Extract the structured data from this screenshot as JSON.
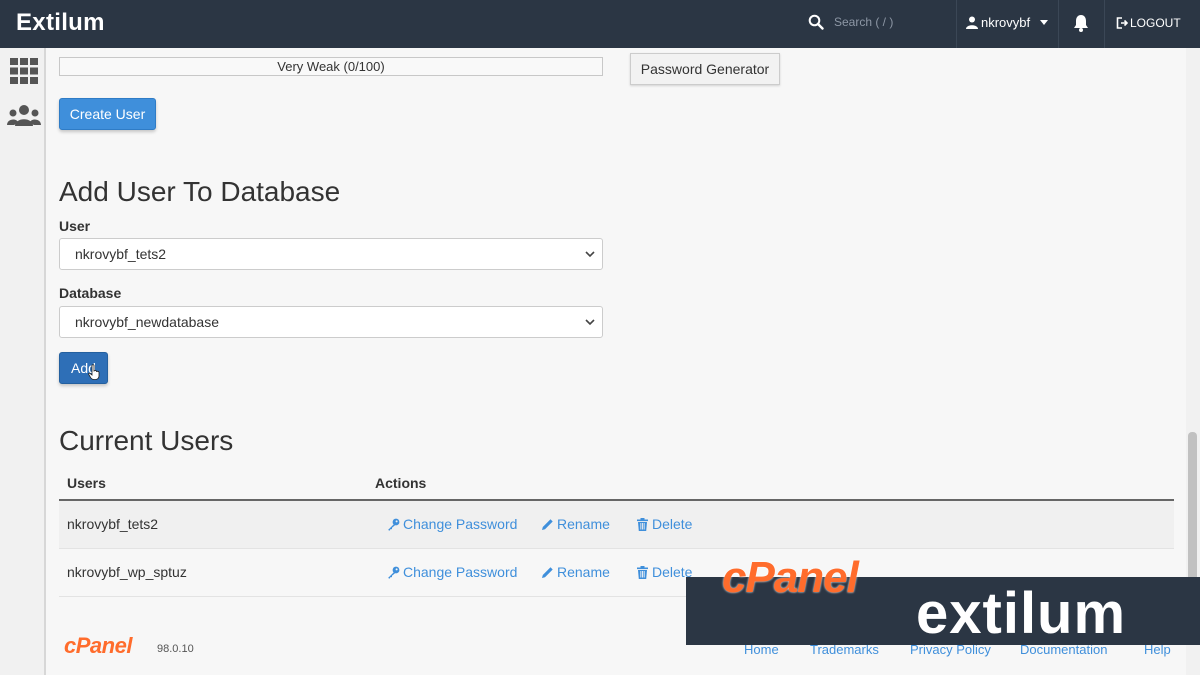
{
  "header": {
    "brand": "Extilum",
    "search_placeholder": "Search ( / )",
    "username": "nkrovybf",
    "logout_label": "LOGOUT"
  },
  "password": {
    "strength_text": "Very Weak (0/100)",
    "generator_label": "Password Generator",
    "create_user_label": "Create User"
  },
  "add_user_to_db": {
    "title": "Add User To Database",
    "user_label": "User",
    "user_value": "nkrovybf_tets2",
    "database_label": "Database",
    "database_value": "nkrovybf_newdatabase",
    "add_label": "Add"
  },
  "current_users": {
    "title": "Current Users",
    "columns": [
      "Users",
      "Actions"
    ],
    "actions": [
      "Change Password",
      "Rename",
      "Delete"
    ],
    "rows": [
      {
        "name": "nkrovybf_tets2"
      },
      {
        "name": "nkrovybf_wp_sptuz"
      }
    ]
  },
  "footer": {
    "logo": "cPanel",
    "version": "98.0.10",
    "links": [
      "Home",
      "Trademarks",
      "Privacy Policy",
      "Documentation",
      "Help"
    ]
  },
  "watermark": {
    "cpanel": "cPanel",
    "brand": "extilum"
  },
  "colors": {
    "topbar": "#2b3644",
    "primary": "#3f8fdb",
    "cpanel_orange": "#ff6c2c"
  }
}
